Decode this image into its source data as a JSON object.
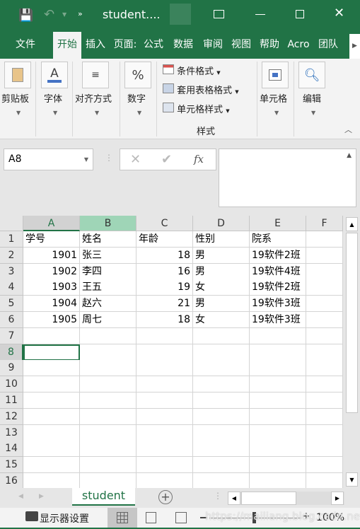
{
  "title": {
    "filename": "student....",
    "icons": [
      "save-icon",
      "undo-icon",
      "more-icon",
      "ribbon-display-icon",
      "minimize-icon",
      "maximize-icon",
      "close-icon"
    ]
  },
  "tabs": [
    "文件",
    "开始",
    "插入",
    "页面:",
    "公式",
    "数据",
    "审阅",
    "视图",
    "帮助",
    "Acro",
    "团队"
  ],
  "active_tab": "开始",
  "ribbon": {
    "clipboard": "剪贴板",
    "font": "字体",
    "align": "对齐方式",
    "number": "数字",
    "cond_format": "条件格式",
    "table_format": "套用表格格式",
    "cell_style": "单元格样式",
    "styles_group": "样式",
    "cells": "单元格",
    "edit": "编辑",
    "percent": "%",
    "font_letter": "A"
  },
  "formula_bar": {
    "name_box": "A8",
    "fx": "fx",
    "formula": ""
  },
  "columns": [
    "A",
    "B",
    "C",
    "D",
    "E",
    "F"
  ],
  "rows": [
    "1",
    "2",
    "3",
    "4",
    "5",
    "6",
    "7",
    "8",
    "9",
    "10",
    "11",
    "12",
    "13",
    "14",
    "15",
    "16"
  ],
  "table": [
    [
      "学号",
      "姓名",
      "年龄",
      "性别",
      "院系"
    ],
    [
      "1901",
      "张三",
      "18",
      "男",
      "19软件2班"
    ],
    [
      "1902",
      "李四",
      "16",
      "男",
      "19软件4班"
    ],
    [
      "1903",
      "王五",
      "19",
      "女",
      "19软件2班"
    ],
    [
      "1904",
      "赵六",
      "21",
      "男",
      "19软件3班"
    ],
    [
      "1905",
      "周七",
      "18",
      "女",
      "19软件3班"
    ]
  ],
  "selected_cell": "A8",
  "sheet_tab": "student",
  "status": {
    "display_settings": "显示器设置",
    "zoom": "100%",
    "watermark": "https://mailiang.blog.csdn.net"
  },
  "colors": {
    "accent": "#217346",
    "selected_col_header": "#9fd5b7"
  }
}
